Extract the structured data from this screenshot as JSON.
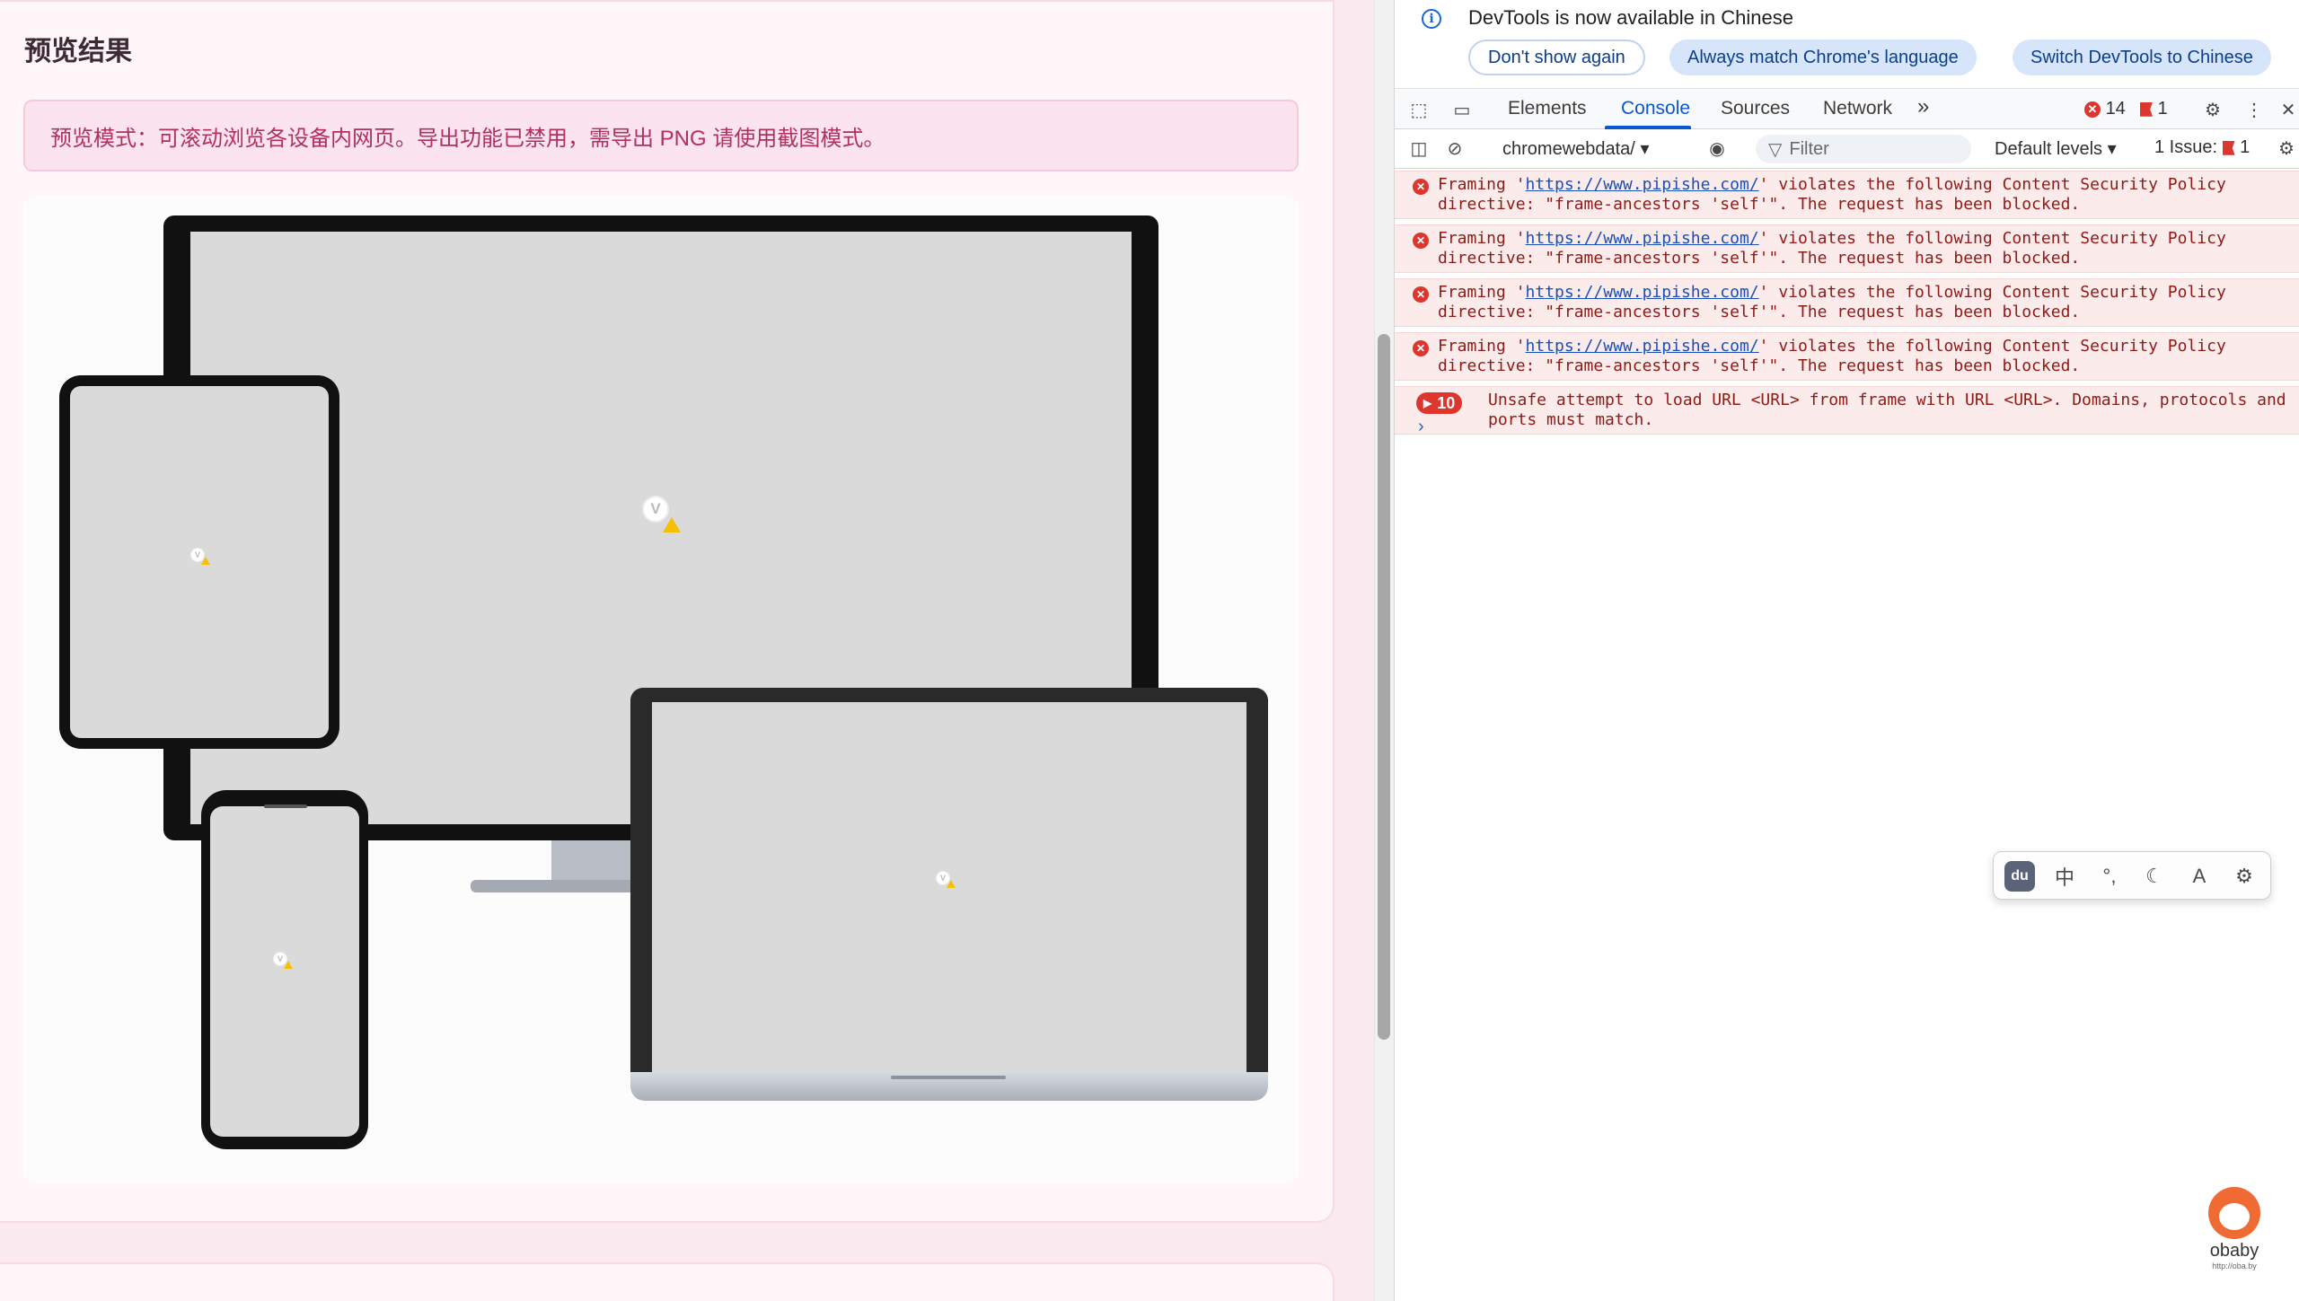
{
  "page": {
    "title": "预览结果",
    "notice": "预览模式：可滚动浏览各设备内网页。导出功能已禁用，需导出 PNG 请使用截图模式。",
    "devices": [
      {
        "name": "desktop-monitor",
        "icon": "vue-broken-image-icon"
      },
      {
        "name": "tablet",
        "icon": "vue-broken-image-icon"
      },
      {
        "name": "phone",
        "icon": "vue-broken-image-icon"
      },
      {
        "name": "laptop",
        "icon": "vue-broken-image-icon"
      }
    ]
  },
  "devtools": {
    "infobar": {
      "text": "DevTools is now available in Chinese",
      "dont_show": "Don't show again",
      "match_language": "Always match Chrome's language",
      "switch_chinese": "Switch DevTools to Chinese"
    },
    "tabs": [
      "Elements",
      "Console",
      "Sources",
      "Network"
    ],
    "more_tabs": "»",
    "error_count": "14",
    "issue_flag_count": "1",
    "toolbar": {
      "context": "chromewebdata/",
      "filter_placeholder": "Filter",
      "levels": "Default levels",
      "issues_label": "1 Issue:",
      "issues_count": "1"
    },
    "messages": [
      {
        "prefix": "Framing '",
        "url": "https://www.pipishe.com/",
        "suffix": "' violates the following Content Security Policy directive: \"frame-ancestors 'self'\". The request has been blocked."
      },
      {
        "prefix": "Framing '",
        "url": "https://www.pipishe.com/",
        "suffix": "' violates the following Content Security Policy directive: \"frame-ancestors 'self'\". The request has been blocked."
      },
      {
        "prefix": "Framing '",
        "url": "https://www.pipishe.com/",
        "suffix": "' violates the following Content Security Policy directive: \"frame-ancestors 'self'\". The request has been blocked."
      },
      {
        "prefix": "Framing '",
        "url": "https://www.pipishe.com/",
        "suffix": "' violates the following Content Security Policy directive: \"frame-ancestors 'self'\". The request has been blocked."
      }
    ],
    "grouped_message": {
      "count": "10",
      "text": "Unsafe attempt to load URL <URL> from frame with URL <URL>. Domains, protocols and ports must match."
    },
    "prompt": "›"
  },
  "ime": {
    "logo": "du",
    "items": [
      "中",
      "°,",
      "☾",
      "A",
      "⚙"
    ]
  },
  "watermark": {
    "label": "obaby",
    "url": "http://oba.by"
  },
  "colors": {
    "accent": "#0b57d0",
    "error": "#dc362e",
    "notice_text": "#b0305e",
    "page_bg": "#fbe9f0"
  }
}
